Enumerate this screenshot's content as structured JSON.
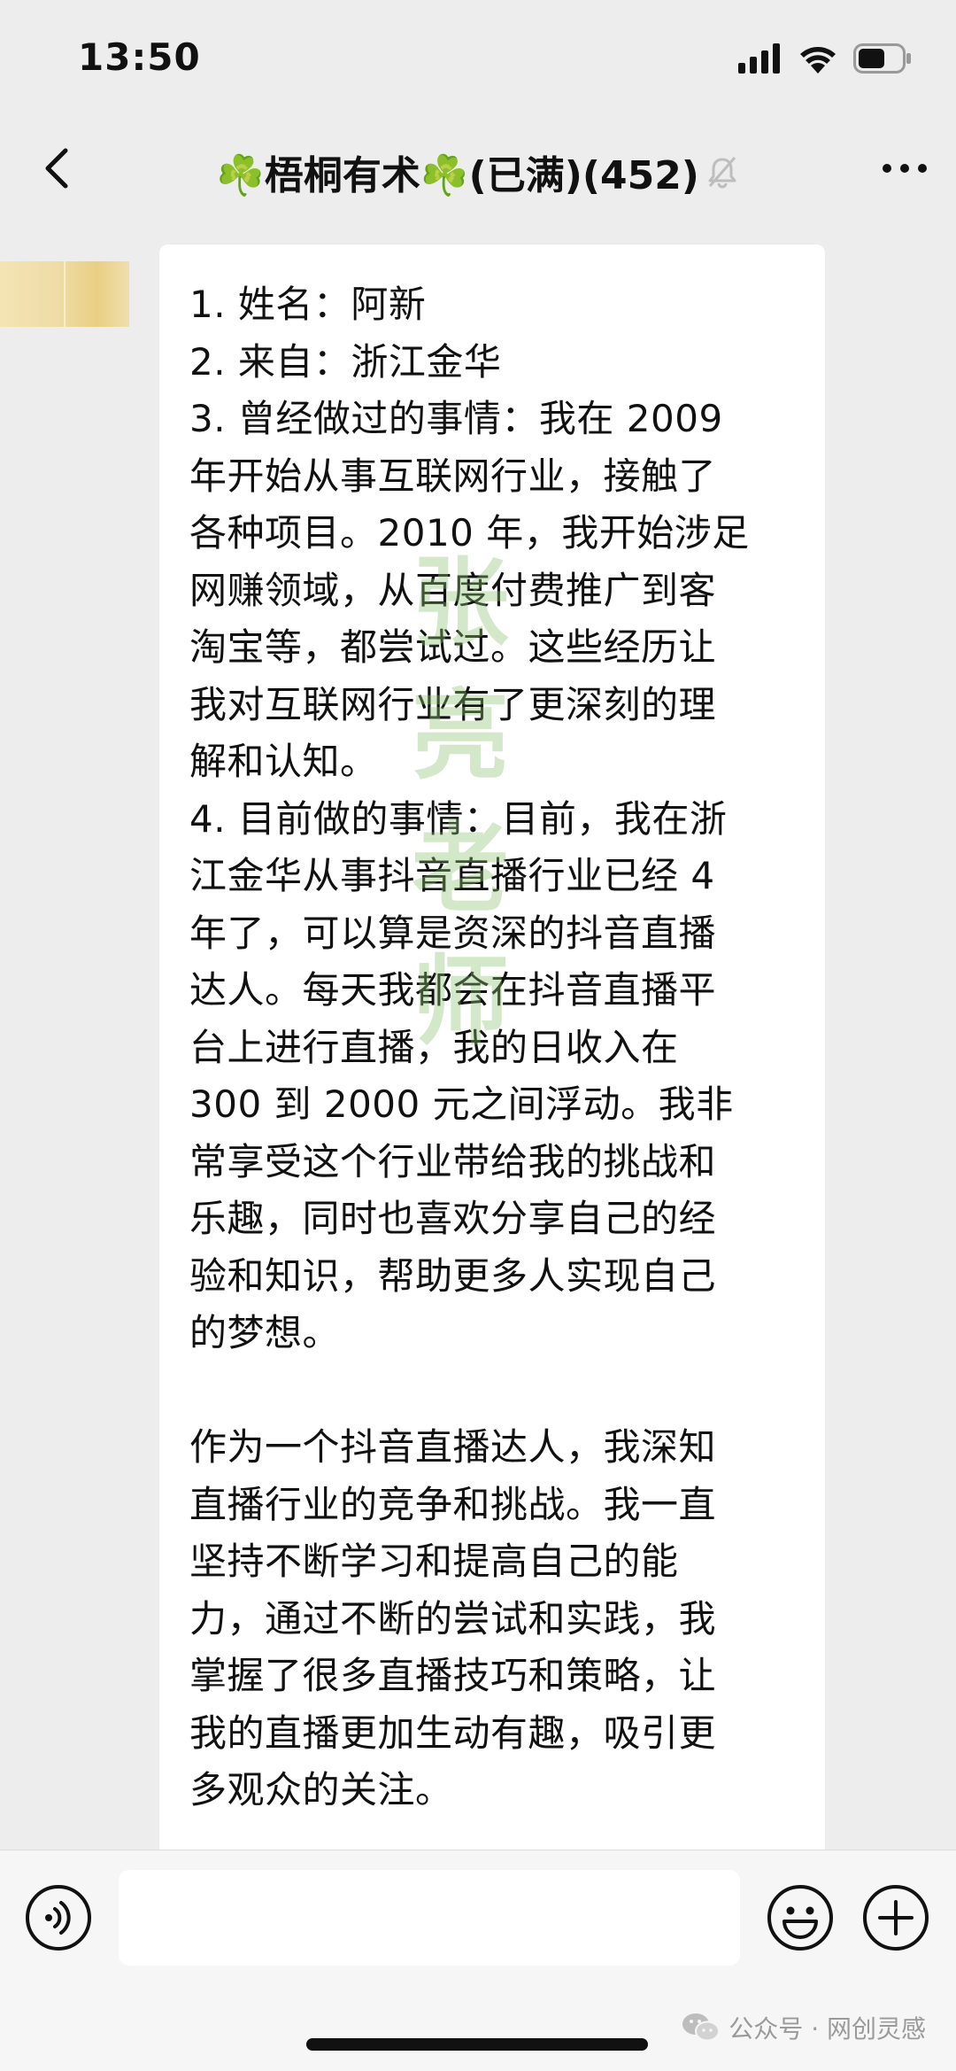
{
  "status_bar": {
    "time": "13:50",
    "battery_level": 0.6
  },
  "nav": {
    "title": "☘️梧桐有术☘️(已满)(452)",
    "back_icon": "chevron-left-icon",
    "mute_icon": "bell-muted-icon",
    "more_icon": "more-dots-icon"
  },
  "message": {
    "lines": [
      "1. 姓名：阿新",
      "2. 来自：浙江金华",
      "3. 曾经做过的事情：我在 2009",
      "年开始从事互联网行业，接触了",
      "各种项目。2010 年，我开始涉足",
      "网赚领域，从百度付费推广到客",
      "淘宝等，都尝试过。这些经历让",
      "我对互联网行业有了更深刻的理",
      "解和认知。",
      "4. 目前做的事情：目前，我在浙",
      "江金华从事抖音直播行业已经 4",
      "年了，可以算是资深的抖音直播",
      "达人。每天我都会在抖音直播平",
      "台上进行直播，我的日收入在",
      "300 到 2000 元之间浮动。我非",
      "常享受这个行业带给我的挑战和",
      "乐趣，同时也喜欢分享自己的经",
      "验和知识，帮助更多人实现自己",
      "的梦想。",
      "",
      "作为一个抖音直播达人，我深知",
      "直播行业的竞争和挑战。我一直",
      "坚持不断学习和提高自己的能",
      "力，通过不断的尝试和实践，我",
      "掌握了很多直播技巧和策略，让",
      "我的直播更加生动有趣，吸引更",
      "多观众的关注。"
    ],
    "watermark": "张亮老师"
  },
  "input_bar": {
    "input_value": "",
    "voice_icon": "voice-icon",
    "emoji_icon": "emoji-icon",
    "plus_icon": "plus-circle-icon"
  },
  "footer": {
    "brand": "公众号 · 网创灵感"
  },
  "colors": {
    "background": "#ededed",
    "bubble": "#ffffff",
    "watermark": "#8cc36e"
  }
}
